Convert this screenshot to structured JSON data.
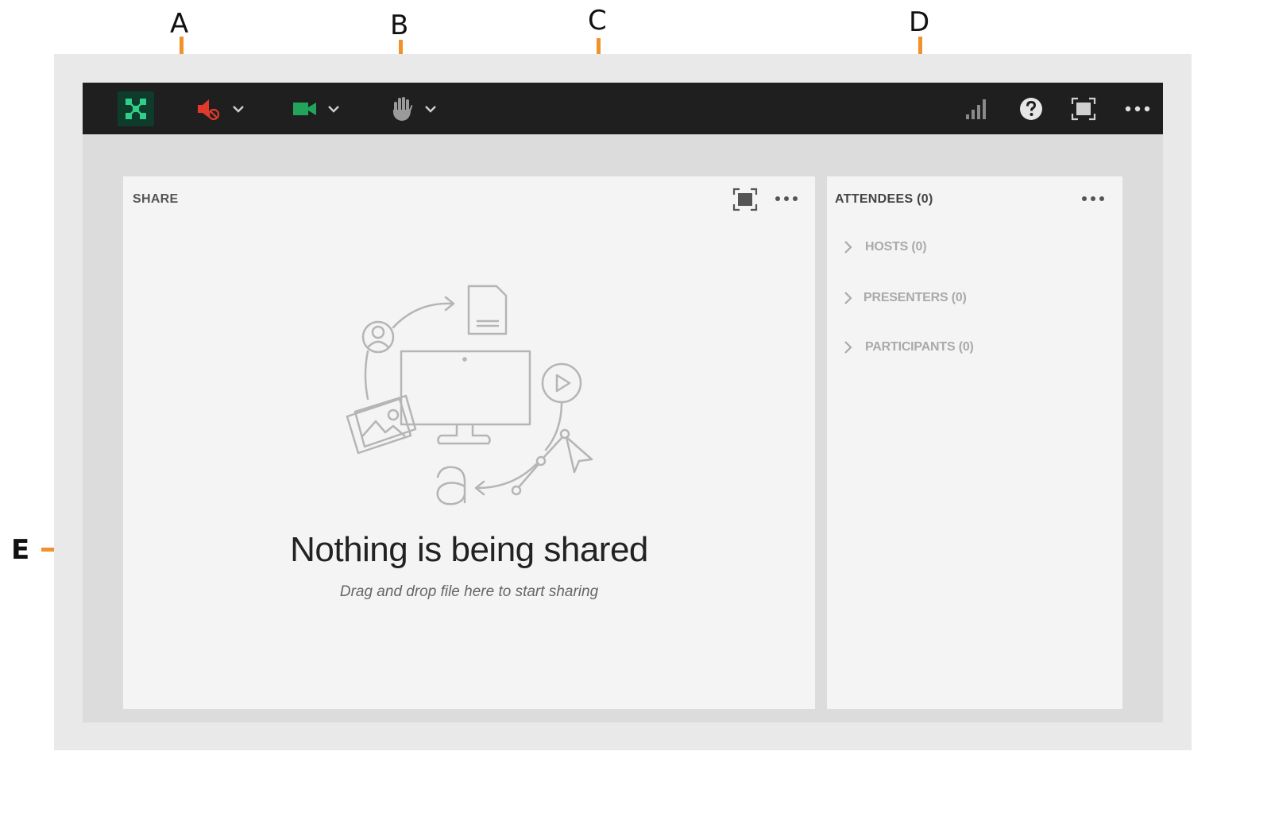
{
  "callouts": [
    "A",
    "B",
    "C",
    "D",
    "E"
  ],
  "toolbar": {
    "left_icons": [
      "meeting-logo-icon",
      "microphone-muted-icon",
      "camera-icon",
      "raise-hand-icon"
    ],
    "right_icons": [
      "connection-strength-icon",
      "help-icon",
      "fullscreen-icon",
      "more-options-icon"
    ],
    "colors": {
      "bar": "#1f1f1f",
      "logo": "#1b8a5a",
      "mic": "#e03a2d",
      "camera": "#22a55b"
    }
  },
  "share_pod": {
    "title": "SHARE",
    "empty_title": "Nothing is being shared",
    "empty_subtitle": "Drag and drop file here to start sharing"
  },
  "attendees_pod": {
    "title": "ATTENDEES (0)",
    "groups": [
      "HOSTS (0)",
      "PRESENTERS (0)",
      "PARTICIPANTS (0)"
    ]
  },
  "accent_color": "#f0922c"
}
